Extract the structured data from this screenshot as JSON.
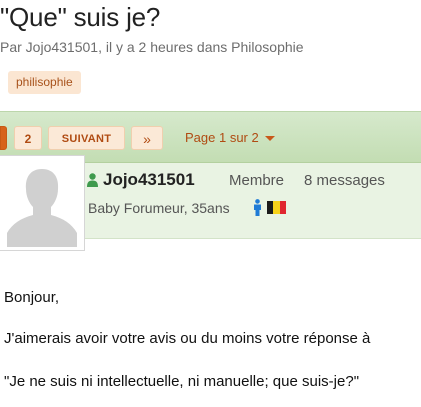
{
  "topic": {
    "title": "\"Que\" suis je?",
    "meta": "Par Jojo431501, il y a 2 heures dans Philosophie",
    "tag": "philisophie"
  },
  "pagination": {
    "current_page": "1",
    "page_2": "2",
    "next_label": "SUIVANT",
    "last_label": "»",
    "jump_label": "Page 1 sur 2"
  },
  "author": {
    "name": "Jojo431501",
    "role": "Membre",
    "messages": "8 messages",
    "rank": "Baby Forumeur, 35ans",
    "icons": [
      "user-icon",
      "male-icon",
      "belgium-flag-icon",
      "default-avatar"
    ]
  },
  "post": {
    "lines": [
      "Bonjour,",
      "J'aimerais avoir votre avis ou du moins votre réponse à",
      "\"Je ne suis ni intellectuelle, ni manuelle; que suis-je?\""
    ]
  },
  "colors": {
    "accent_orange": "#d7631b",
    "tag_bg": "#fbe6d2",
    "pager_green": "#c9e1ba",
    "author_bar": "#e9f3e3",
    "user_icon_green": "#3f9a4e",
    "male_icon_blue": "#1f7bd6"
  }
}
